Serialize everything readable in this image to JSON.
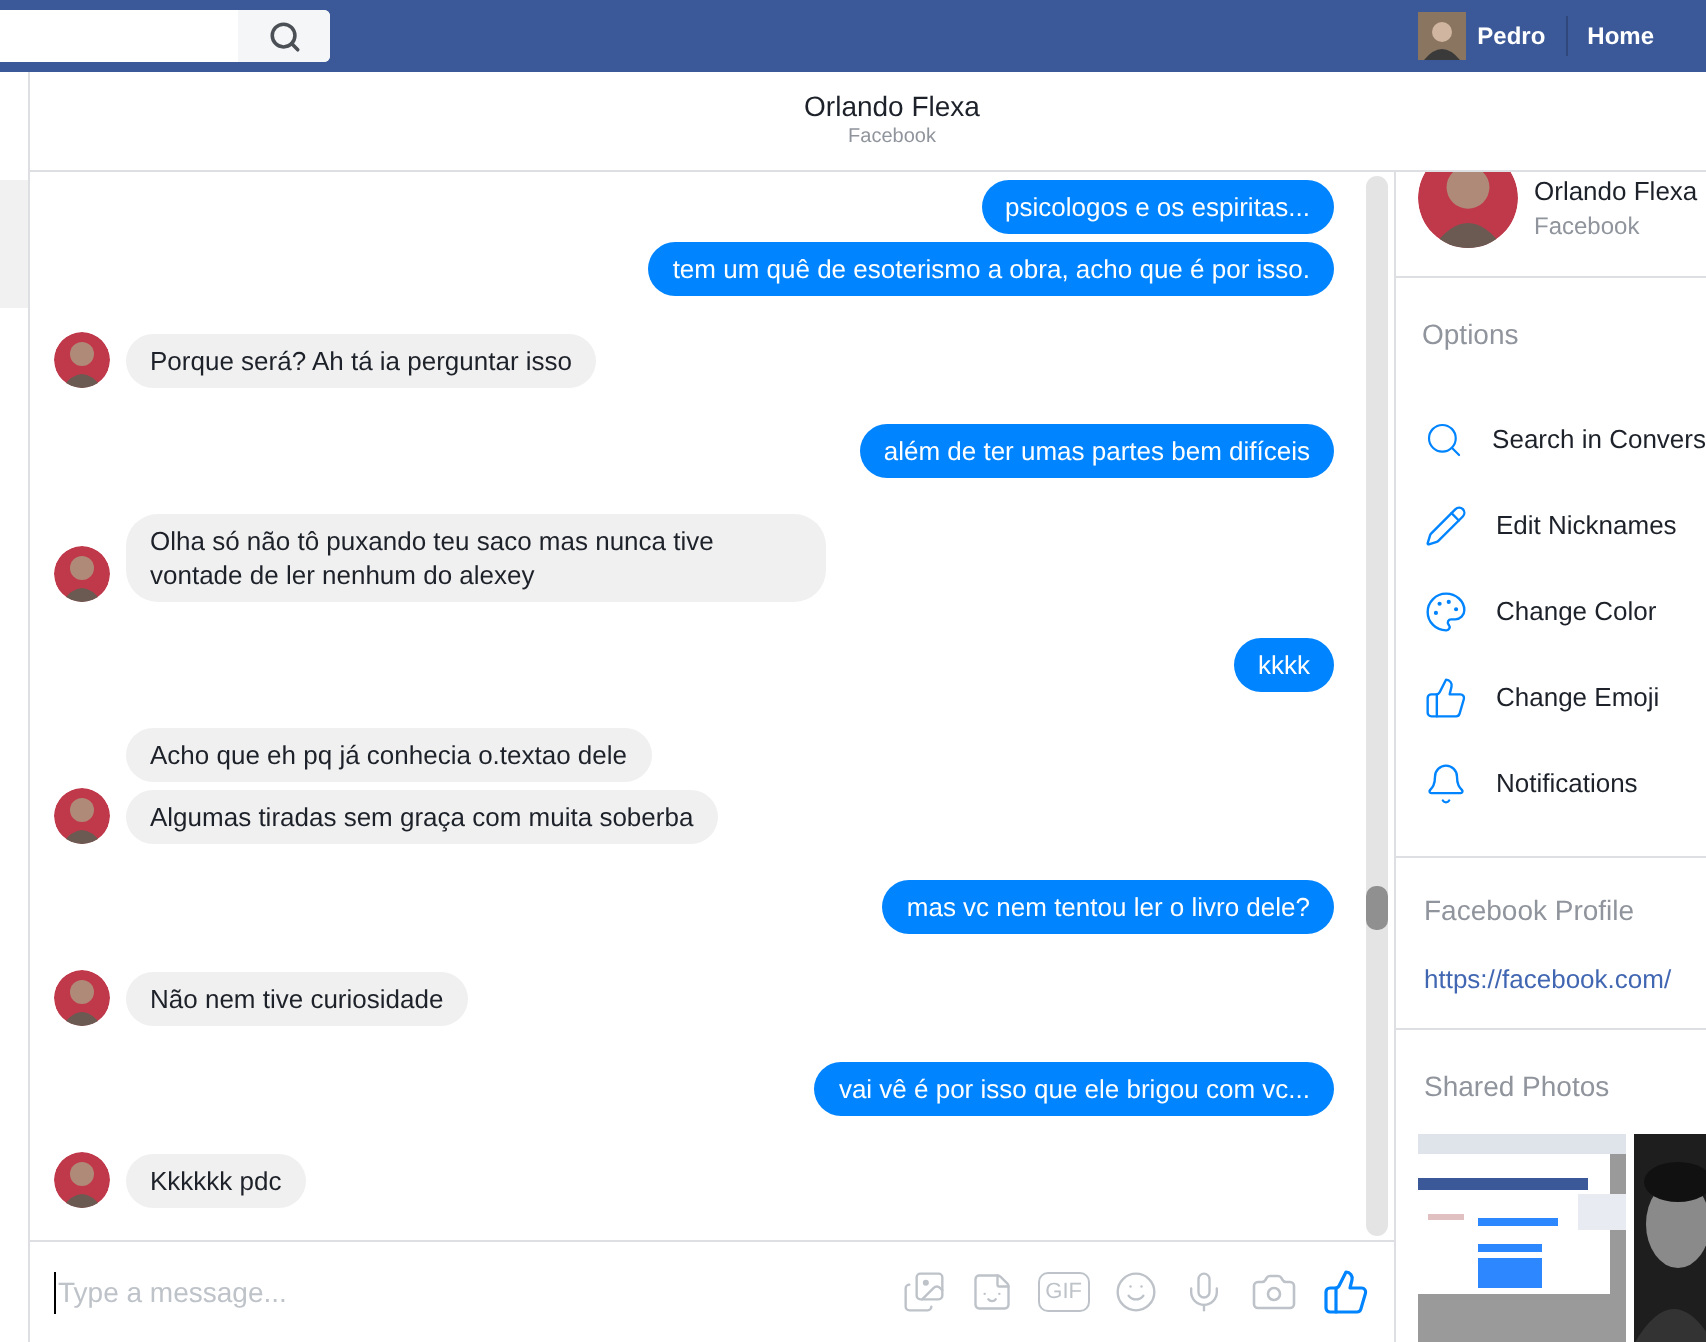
{
  "topbar": {
    "user_name": "Pedro",
    "home_link": "Home"
  },
  "chat_header": {
    "title": "Orlando Flexa",
    "subtitle": "Facebook"
  },
  "messages": [
    {
      "kind": "sent",
      "texts": [
        "psicologos e os espiritas...",
        "tem um quê de esoterismo a obra, acho que é por isso."
      ]
    },
    {
      "kind": "received",
      "texts": [
        "Porque será?  Ah tá ia perguntar isso"
      ]
    },
    {
      "kind": "sent",
      "texts": [
        "além de ter umas partes bem difíceis"
      ]
    },
    {
      "kind": "received",
      "texts": [
        "Olha só não tô puxando teu saco mas nunca tive vontade de ler nenhum do alexey"
      ]
    },
    {
      "kind": "sent",
      "texts": [
        "kkkk"
      ]
    },
    {
      "kind": "received",
      "texts": [
        "Acho que eh pq já conhecia o.textao dele",
        "Algumas tiradas sem graça com muita soberba"
      ]
    },
    {
      "kind": "sent",
      "texts": [
        "mas vc nem tentou ler o livro dele?"
      ]
    },
    {
      "kind": "received",
      "texts": [
        "Não nem tive curiosidade"
      ]
    },
    {
      "kind": "sent",
      "texts": [
        "vai vê é por isso que ele brigou com vc..."
      ]
    },
    {
      "kind": "received",
      "texts": [
        "Kkkkkk pdc"
      ]
    }
  ],
  "composer": {
    "placeholder": "Type a message...",
    "gif_label": "GIF"
  },
  "profile": {
    "name": "Orlando Flexa",
    "source": "Facebook"
  },
  "options": {
    "heading": "Options",
    "items": [
      {
        "kind": "search",
        "label": "Search in Convers"
      },
      {
        "kind": "edit",
        "label": "Edit Nicknames"
      },
      {
        "kind": "color",
        "label": "Change Color"
      },
      {
        "kind": "emoji",
        "label": "Change Emoji"
      },
      {
        "kind": "notifications",
        "label": "Notifications"
      }
    ]
  },
  "facebook_profile": {
    "heading": "Facebook Profile",
    "link": "https://facebook.com/"
  },
  "shared_photos": {
    "heading": "Shared Photos"
  }
}
